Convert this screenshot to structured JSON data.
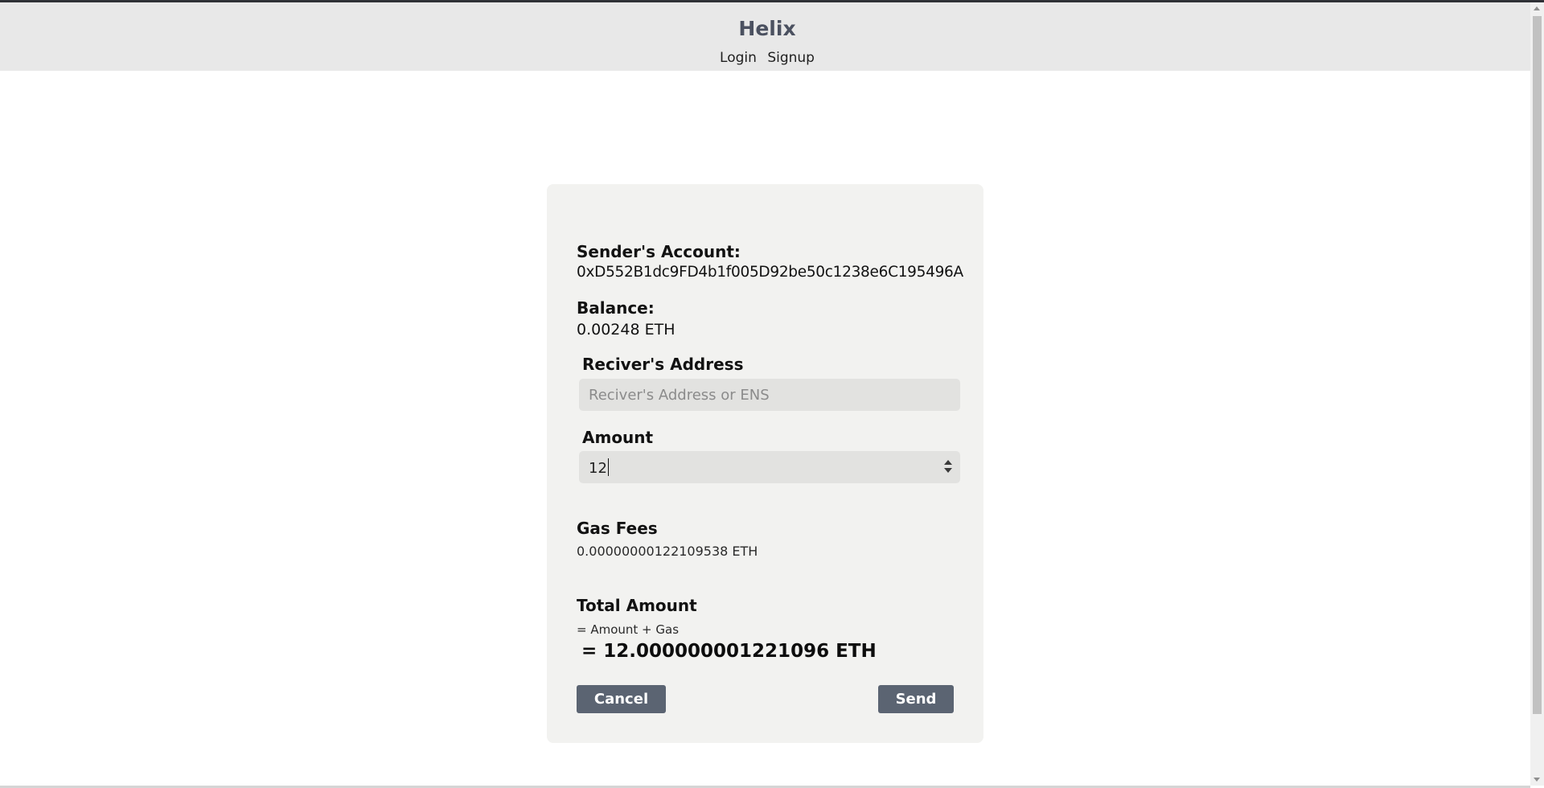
{
  "header": {
    "brand": "Helix",
    "nav": [
      {
        "label": "Login"
      },
      {
        "label": "Signup"
      }
    ]
  },
  "form": {
    "sender_label": "Sender's Account:",
    "sender_address": "0xD552B1dc9FD4b1f005D92be50c1238e6C195496A",
    "balance_label": "Balance:",
    "balance_value": "0.00248 ETH",
    "receiver_label": "Reciver's Address",
    "receiver_placeholder": "Reciver's Address or ENS",
    "receiver_value": "",
    "amount_label": "Amount",
    "amount_value": "12",
    "gas_label": "Gas Fees",
    "gas_value": "0.00000000122109538 ETH",
    "total_label": "Total Amount",
    "total_formula": "= Amount + Gas",
    "total_value": "= 12.000000001221096 ETH",
    "cancel_label": "Cancel",
    "send_label": "Send"
  },
  "colors": {
    "header_bg": "#e8e8e8",
    "brand": "#4b5160",
    "card_bg": "#f2f2f0",
    "input_bg": "#e2e2e0",
    "button_bg": "#5b6472"
  },
  "icons": {
    "stepper": "up-down-arrows-icon",
    "scrollbar": "vertical-scrollbar"
  }
}
